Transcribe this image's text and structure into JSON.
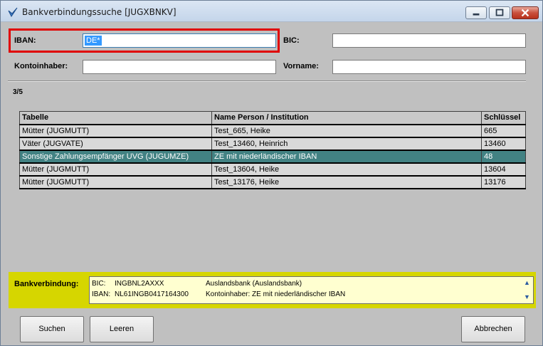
{
  "window": {
    "title": "Bankverbindungssuche [JUGXBNKV]"
  },
  "form": {
    "iban_label": "IBAN:",
    "iban_value": "DE*",
    "bic_label": "BIC:",
    "bic_value": "",
    "kontoinhaber_label": "Kontoinhaber:",
    "kontoinhaber_value": "",
    "vorname_label": "Vorname:",
    "vorname_value": ""
  },
  "result_count": "3/5",
  "table": {
    "columns": [
      "Tabelle",
      "Name Person / Institution",
      "Schlüssel"
    ],
    "rows": [
      {
        "tabelle": "Mütter (JUGMUTT)",
        "name": "Test_665, Heike",
        "schluessel": "665"
      },
      {
        "tabelle": "Väter (JUGVATE)",
        "name": "Test_13460, Heinrich",
        "schluessel": "13460"
      },
      {
        "tabelle": "Sonstige Zahlungsempfänger UVG (JUGUMZE)",
        "name": "ZE mit niederländischer IBAN",
        "schluessel": "48"
      },
      {
        "tabelle": "Mütter (JUGMUTT)",
        "name": "Test_13604, Heike",
        "schluessel": "13604"
      },
      {
        "tabelle": "Mütter (JUGMUTT)",
        "name": "Test_13176, Heike",
        "schluessel": "13176"
      }
    ],
    "selected_row": 3
  },
  "bank": {
    "label": "Bankverbindung:",
    "bic_key": "BIC:",
    "bic_value": "INGBNL2AXXX",
    "bank_name": "Auslandsbank (Auslandsbank)",
    "iban_key": "IBAN:",
    "iban_value": "NL61INGB0417164300",
    "holder": "Kontoinhaber: ZE mit niederländischer IBAN"
  },
  "buttons": {
    "suchen": "Suchen",
    "leeren": "Leeren",
    "abbrechen": "Abbrechen"
  },
  "colors": {
    "selected_row": "#428283",
    "bank_panel": "#d6d600",
    "highlight": "#e00000"
  }
}
